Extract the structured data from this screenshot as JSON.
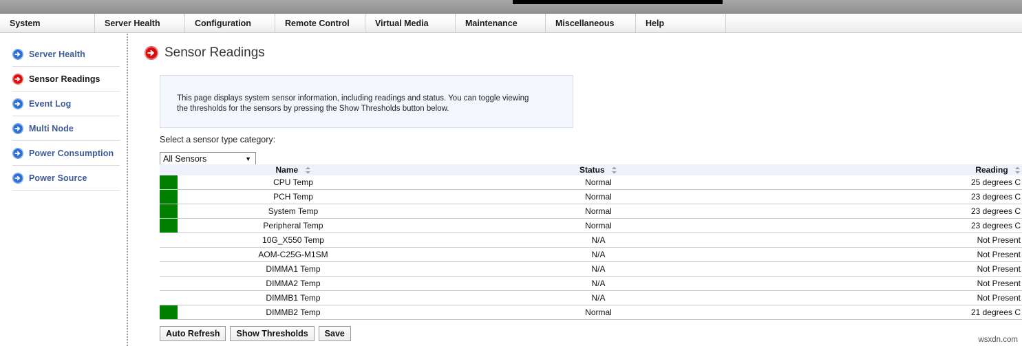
{
  "menu": {
    "items": [
      {
        "label": "System",
        "key": "system"
      },
      {
        "label": "Server Health",
        "key": "server-health"
      },
      {
        "label": "Configuration",
        "key": "configuration"
      },
      {
        "label": "Remote Control",
        "key": "remote-control"
      },
      {
        "label": "Virtual Media",
        "key": "virtual-media"
      },
      {
        "label": "Maintenance",
        "key": "maintenance"
      },
      {
        "label": "Miscellaneous",
        "key": "miscellaneous"
      },
      {
        "label": "Help",
        "key": "help"
      }
    ]
  },
  "sidebar": {
    "items": [
      {
        "label": "Server Health",
        "icon": "blue-arrow-circle-icon",
        "active": false
      },
      {
        "label": "Sensor Readings",
        "icon": "red-arrow-circle-icon",
        "active": true
      },
      {
        "label": "Event Log",
        "icon": "blue-arrow-circle-icon",
        "active": false
      },
      {
        "label": "Multi Node",
        "icon": "blue-arrow-circle-icon",
        "active": false
      },
      {
        "label": "Power Consumption",
        "icon": "blue-arrow-circle-icon",
        "active": false
      },
      {
        "label": "Power Source",
        "icon": "blue-arrow-circle-icon",
        "active": false
      }
    ]
  },
  "page": {
    "title": "Sensor Readings",
    "title_icon": "red-arrow-circle-icon",
    "info_text": "This page displays system sensor information, including readings and status. You can toggle viewing the thresholds for the sensors by pressing the Show Thresholds button below.",
    "select_label": "Select a sensor type category:",
    "watermark": "wsxdn.com"
  },
  "sensor_select": {
    "value": "All Sensors",
    "arrow_icon": "chevron-down-icon"
  },
  "table": {
    "headers": {
      "led": "",
      "name": "Name",
      "status": "Status",
      "reading": "Reading"
    },
    "sort_icon": "sort-arrows-icon",
    "rows": [
      {
        "led": "green",
        "name": "CPU Temp",
        "status": "Normal",
        "reading": "25 degrees C"
      },
      {
        "led": "green",
        "name": "PCH Temp",
        "status": "Normal",
        "reading": "23 degrees C"
      },
      {
        "led": "green",
        "name": "System Temp",
        "status": "Normal",
        "reading": "23 degrees C"
      },
      {
        "led": "green",
        "name": "Peripheral Temp",
        "status": "Normal",
        "reading": "23 degrees C"
      },
      {
        "led": "none",
        "name": "10G_X550 Temp",
        "status": "N/A",
        "reading": "Not Present"
      },
      {
        "led": "none",
        "name": "AOM-C25G-M1SM",
        "status": "N/A",
        "reading": "Not Present"
      },
      {
        "led": "none",
        "name": "DIMMA1 Temp",
        "status": "N/A",
        "reading": "Not Present"
      },
      {
        "led": "none",
        "name": "DIMMA2 Temp",
        "status": "N/A",
        "reading": "Not Present"
      },
      {
        "led": "none",
        "name": "DIMMB1 Temp",
        "status": "N/A",
        "reading": "Not Present"
      },
      {
        "led": "green",
        "name": "DIMMB2 Temp",
        "status": "Normal",
        "reading": "21 degrees C"
      }
    ]
  },
  "buttons": [
    {
      "label": "Auto Refresh",
      "key": "auto-refresh"
    },
    {
      "label": "Show Thresholds",
      "key": "show-thresholds"
    },
    {
      "label": "Save",
      "key": "save"
    }
  ],
  "colors": {
    "led_green": "#008000",
    "sidebar_link": "#3c5a9a",
    "accent_red": "#d90d0d",
    "accent_blue": "#2a6ed4",
    "table_header_bg": "#eef1fb",
    "info_box_bg": "#f3f6fd"
  }
}
